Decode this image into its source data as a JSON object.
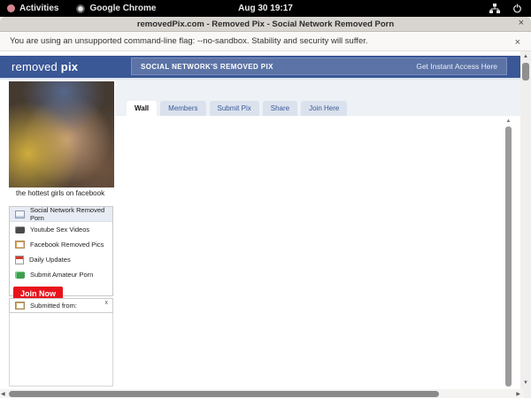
{
  "desktop": {
    "activities": "Activities",
    "app_menu": "Google Chrome",
    "clock": "Aug 30 19:17"
  },
  "window": {
    "title": "removedPix.com - Removed Pix - Social Network Removed Porn",
    "close": "×"
  },
  "warning": {
    "message": "You are using an unsupported command-line flag: --no-sandbox. Stability and security will suffer.",
    "close": "×"
  },
  "site": {
    "logo": {
      "first": "removed",
      "second": "pix"
    },
    "tagline": "SOCIAL NETWORK'S REMOVED PIX",
    "access_link": "Get Instant Access Here",
    "tabs": [
      {
        "label": "Wall",
        "active": true
      },
      {
        "label": "Members",
        "active": false
      },
      {
        "label": "Submit Pix",
        "active": false
      },
      {
        "label": "Share",
        "active": false
      },
      {
        "label": "Join Here",
        "active": false
      }
    ],
    "sidebar": {
      "caption": "the hottest girls on facebook",
      "menu": [
        {
          "label": "Social Network Removed Porn",
          "icon": "feed-icon",
          "highlighted": true
        },
        {
          "label": "Youtube Sex Videos",
          "icon": "video-icon",
          "highlighted": false
        },
        {
          "label": "Facebook Removed Pics",
          "icon": "photo-icon",
          "highlighted": false
        },
        {
          "label": "Daily Updates",
          "icon": "calendar-icon",
          "highlighted": false
        },
        {
          "label": "Submit Amateur Porn",
          "icon": "camera-icon",
          "highlighted": false
        }
      ],
      "join_button": "Join Now",
      "submitted_from": "Submitted from:",
      "submitted_close": "x"
    }
  },
  "scrollbars": {
    "up_arrow": "▲",
    "down_arrow": "▼",
    "left_arrow": "◀",
    "right_arrow": "▶"
  },
  "colors": {
    "topbar_black": "#000000",
    "header_blue": "#3a5796",
    "header_inner_blue": "#5b73a6",
    "facebook_blue": "#3b5998",
    "tab_strip": "#eef1f5",
    "join_red": "#e8141c"
  }
}
